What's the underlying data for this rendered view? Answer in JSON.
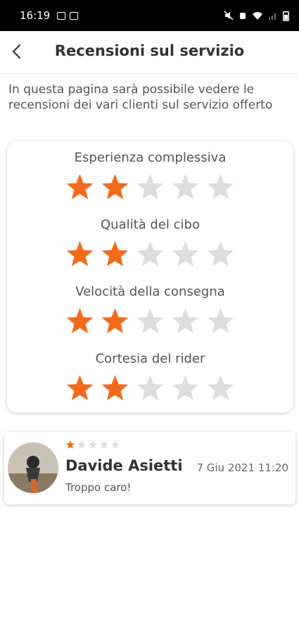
{
  "status_bar": {
    "time": "16:19"
  },
  "header": {
    "title": "Recensioni sul servizio",
    "back_icon": "chevron-left-icon"
  },
  "intro_text": "In questa pagina sarà possibile vedere le recensioni dei vari clienti sul servizio offerto",
  "colors": {
    "star_filled": "#F26B1D",
    "star_empty": "#DDDDDD"
  },
  "ratings": [
    {
      "label": "Esperienza complessiva",
      "score": 2,
      "max": 5
    },
    {
      "label": "Qualità del cibo",
      "score": 2,
      "max": 5
    },
    {
      "label": "Velocità della consegna",
      "score": 2,
      "max": 5
    },
    {
      "label": "Cortesia del rider",
      "score": 2,
      "max": 5
    }
  ],
  "reviews": [
    {
      "name": "Davide Asietti",
      "date": "7 Giu 2021 11:20",
      "comment": "Troppo caro!",
      "stars": 1,
      "max": 5
    }
  ]
}
